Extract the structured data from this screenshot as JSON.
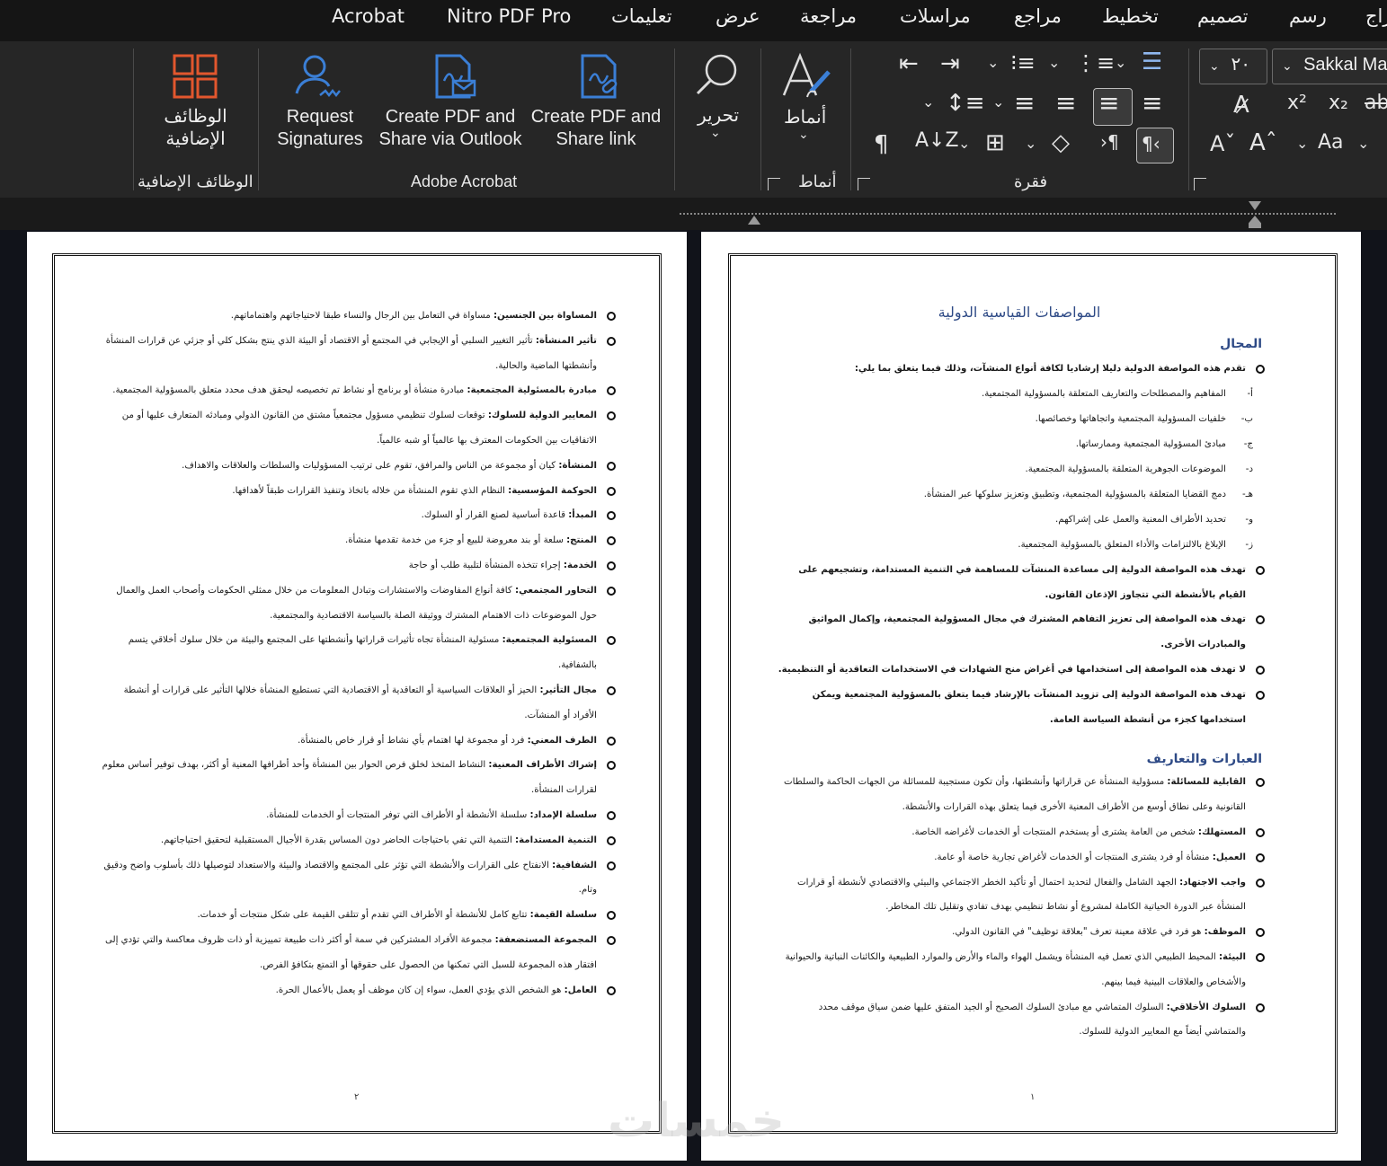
{
  "tabs": [
    "Acrobat",
    "Nitro PDF Pro",
    "تعليمات",
    "عرض",
    "مراجعة",
    "مراسلات",
    "مراجع",
    "تخطيط",
    "تصميم",
    "رسم",
    "إدراج"
  ],
  "ribbon": {
    "addins_label": "الوظائف الإضافية",
    "addins_group": "الوظائف الإضافية",
    "request_signatures": "Request Signatures",
    "create_pdf_outlook": "Create PDF and Share via Outlook",
    "create_pdf_link": "Create PDF and Share link",
    "acrobat_group": "Adobe Acrobat",
    "edit_label": "تحرير",
    "styles_label": "أنماط",
    "styles_group": "أنماط",
    "paragraph_group": "فقرة",
    "font_name": "Sakkal Majalla",
    "font_size": "٢٠"
  },
  "page1": {
    "title": "المواصفات القياسية الدولية",
    "section1": "المجال",
    "intro": "تقدم هذه المواصفة الدولية دليلا إرشاديا لكافة أنواع المنشآت، وذلك فيما يتعلق بما يلي:",
    "subitems": [
      {
        "letter": "أ-",
        "text": "المفاهيم والمصطلحات والتعاريف المتعلقة بالمسؤولية المجتمعية."
      },
      {
        "letter": "ب-",
        "text": "خلفيات المسؤولية المجتمعية واتجاهاتها وخصائصها."
      },
      {
        "letter": "ج-",
        "text": "مبادئ المسؤولية المجتمعية وممارساتها."
      },
      {
        "letter": "د-",
        "text": "الموضوعات الجوهرية المتعلقة بالمسؤولية المجتمعية."
      },
      {
        "letter": "هـ-",
        "text": "دمج القضايا المتعلقة بالمسؤولية المجتمعية، وتطبيق وتعزيز سلوكها عبر المنشأة."
      },
      {
        "letter": "و-",
        "text": "تحديد الأطراف المعنية والعمل على إشراكهم."
      },
      {
        "letter": "ز-",
        "text": "الإبلاغ بالالتزامات والأداء المتعلق بالمسؤولية المجتمعية."
      }
    ],
    "bold_items": [
      "تهدف هذه المواصفة الدولية إلى مساعدة المنشآت للمساهمة في التنمية المستدامة، وتشجيعهم على القيام بالأنشطة التي تتجاوز الإذعان القانون.",
      "تهدف هذه المواصفة إلى تعزيز التفاهم المشترك في مجال المسؤولية المجتمعية، وإكمال المواثيق والمبادرات الأخرى.",
      "لا تهدف هذه المواصفة إلى استخدامها في أغراض منح الشهادات في الاستخدامات التعاقدية أو التنظيمية.",
      "تهدف هذه المواصفة الدولية إلى تزويد المنشآت بالإرشاد فيما يتعلق بالمسؤولية المجتمعية ويمكن استخدامها كجزء من أنشطة السياسة العامة."
    ],
    "section2": "العبارات والتعاريف",
    "defs": [
      {
        "term": "القابلية للمسائلة:",
        "text": " مسؤولية المنشأة عن قراراتها وأنشطتها، وأن تكون مستجيبة للمسائلة من الجهات الحاكمة والسلطات القانونية وعلى نطاق أوسع من الأطراف المعنية الأخرى فيما يتعلق بهذه القرارات والأنشطة."
      },
      {
        "term": "المستهلك:",
        "text": " شخص من العامة يشترى أو يستخدم المنتجات أو الخدمات لأغراضه الخاصة."
      },
      {
        "term": "العميل:",
        "text": " منشأة أو فرد يشترى المنتجات أو الخدمات لأغراض تجارية خاصة أو عامة."
      },
      {
        "term": "واجب الاجتهاد:",
        "text": " الجهد الشامل والفعال لتحديد احتمال أو تأكيد الخطر الاجتماعي والبيئي والاقتصادي لأنشطة أو قرارات المنشأة عبر الدورة الحياتية الكاملة لمشروع أو نشاط تنظيمي بهدف تفادي وتقليل تلك المخاطر."
      },
      {
        "term": "الموظف:",
        "text": " هو فرد في علاقة معينة تعرف \"بعلاقة توظيف\" في القانون الدولي."
      },
      {
        "term": "البيئة:",
        "text": " المحيط الطبيعي الذي تعمل فيه المنشأة ويشمل الهواء والماء والأرض والموارد الطبيعية والكائنات النباتية والحيوانية والأشخاص والعلاقات البينية فيما بينهم."
      },
      {
        "term": "السلوك الأخلاقي:",
        "text": " السلوك المتماشي مع مبادئ السلوك الصحيح أو الجيد المتفق عليها ضمن سياق موقف محدد والمتماشي أيضاً مع المعايير الدولية للسلوك."
      }
    ],
    "page_number": "١"
  },
  "page2": {
    "defs": [
      {
        "term": "المساواة بين الجنسين:",
        "text": " مساواة في التعامل بين الرجال والنساء طبقا لاحتياجاتهم واهتماماتهم."
      },
      {
        "term": "تأثير المنشأة:",
        "text": " تأثير التغيير السلبي أو الإيجابي في المجتمع أو الاقتصاد أو البيئة الذي ينتج بشكل كلي أو جزئي عن قرارات المنشأة وأنشطتها الماضية والحالية."
      },
      {
        "term": "مبادرة بالمسئولية المجتمعية:",
        "text": " مبادرة منشأة أو برنامج أو نشاط تم تخصيصه ليحقق هدف محدد متعلق بالمسؤولية المجتمعية."
      },
      {
        "term": "المعايير الدولية للسلوك:",
        "text": " توقعات لسلوك تنظيمي مسؤول مجتمعياً مشتق من القانون الدولي ومبادئه المتعارف عليها أو من الاتفاقيات بين الحكومات المعترف بها عالمياً أو شبه عالمياً."
      },
      {
        "term": "المنشأة:",
        "text": " كيان أو مجموعة من الناس والمرافق، تقوم على ترتيب المسؤوليات والسلطات والعلاقات والاهداف."
      },
      {
        "term": "الحوكمة المؤسسية:",
        "text": " النظام الذي تقوم المنشأة من خلاله باتخاذ وتنفيذ القرارات طبقاً لأهدافها."
      },
      {
        "term": "المبدأ:",
        "text": " قاعدة أساسية لصنع القرار أو السلوك."
      },
      {
        "term": "المنتج:",
        "text": " سلعة أو بند معروضة للبيع أو جزء من خدمة تقدمها منشأة."
      },
      {
        "term": "الخدمة:",
        "text": " إجراء تتخذه المنشأة لتلبية طلب أو حاجة"
      },
      {
        "term": "التحاور المجتمعي:",
        "text": " كافة أنواع المفاوضات والاستشارات وتبادل المعلومات من خلال ممثلي الحكومات وأصحاب العمل والعمال حول الموضوعات ذات الاهتمام المشترك ووثيقة الصلة بالسياسة الاقتصادية والمجتمعية."
      },
      {
        "term": "المسئولية المجتمعية:",
        "text": " مسئولية المنشأة تجاه تأثيرات قراراتها وأنشطتها على المجتمع والبيئة من خلال سلوك أخلاقي يتسم بالشفافية."
      },
      {
        "term": "مجال التأثير:",
        "text": " الحيز أو العلاقات السياسية أو التعاقدية أو الاقتصادية التي تستطيع المنشأة خلالها التأثير على قرارات أو أنشطة الأفراد أو المنشآت."
      },
      {
        "term": "الطرف المعني:",
        "text": " فرد أو مجموعة لها اهتمام بأي نشاط أو قرار خاص بالمنشأة."
      },
      {
        "term": "إشراك الأطراف المعنية:",
        "text": " النشاط المتخذ لخلق فرص الحوار بين المنشأة وأحد أطرافها المعنية أو أكثر، بهدف توفير أساس معلوم لقرارات المنشأة."
      },
      {
        "term": "سلسلة الإمداد:",
        "text": " سلسلة الأنشطة أو الأطراف التي توفر المنتجات أو الخدمات للمنشأة."
      },
      {
        "term": "التنمية المستدامة:",
        "text": " التنمية التي تفي باحتياجات الحاضر دون المساس بقدرة الأجيال المستقبلية لتحقيق احتياجاتهم."
      },
      {
        "term": "الشفافية:",
        "text": " الانفتاح على القرارات والأنشطة التي تؤثر على المجتمع والاقتصاد والبيئة والاستعداد لتوصيلها ذلك بأسلوب واضح ودقيق وتام."
      },
      {
        "term": "سلسلة القيمة:",
        "text": " تتابع كامل للأنشطة أو الأطراف التي تقدم أو تتلقى القيمة على شكل منتجات أو خدمات."
      },
      {
        "term": "المجموعة المستضعفة:",
        "text": " مجموعة الأفراد المشتركين في سمة أو أكثر ذات طبيعة تمييزية أو ذات ظروف معاكسة والتي تؤدي إلى افتقار هذه المجموعة للسبل التي تمكنها من الحصول على حقوقها أو التمتع بتكافؤ الفرص."
      },
      {
        "term": "العامل:",
        "text": " هو الشخص الذي يؤدي العمل، سواء إن كان موظف أو يعمل بالأعمال الحرة."
      }
    ],
    "page_number": "٢"
  },
  "watermark": "خمسات"
}
